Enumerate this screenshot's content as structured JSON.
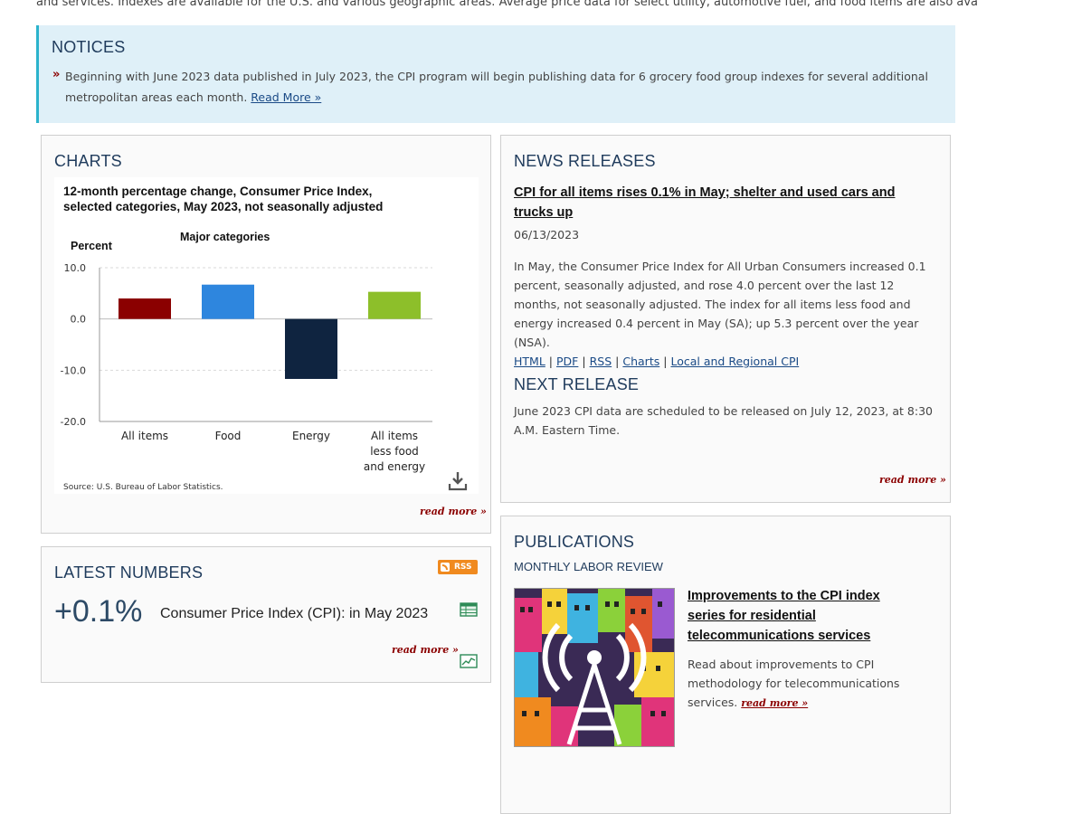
{
  "intro_text": "and services. Indexes are available for the U.S. and various geographic areas. Average price data for select utility, automotive fuel, and food items are also available.",
  "notices": {
    "heading": "NOTICES",
    "text": "Beginning with June 2023 data published in July 2023, the CPI program will begin publishing data for 6 grocery food group indexes for several additional metropolitan areas each month.",
    "read_more": "Read More »"
  },
  "charts": {
    "heading": "CHARTS",
    "read_more": "read more »"
  },
  "chart_data": {
    "type": "bar",
    "title": "12-month percentage change, Consumer Price Index, selected categories, May 2023, not seasonally adjusted",
    "subtitle": "Major categories",
    "ylabel": "Percent",
    "source": "Source: U.S. Bureau of Labor Statistics.",
    "ylim": [
      -20,
      10
    ],
    "yticks": [
      "10.0",
      "0.0",
      "-10.0",
      "-20.0"
    ],
    "grid": true,
    "categories": [
      "All items",
      "Food",
      "Energy",
      "All items less food and energy"
    ],
    "category_lines": [
      [
        "All items"
      ],
      [
        "Food"
      ],
      [
        "Energy"
      ],
      [
        "All items",
        "less food",
        "and energy"
      ]
    ],
    "values": [
      4.0,
      6.7,
      -11.7,
      5.3
    ],
    "colors": [
      "#8b0000",
      "#2e86de",
      "#0f2440",
      "#8dbf2a"
    ]
  },
  "latest": {
    "heading": "LATEST NUMBERS",
    "rss": "RSS",
    "value": "+0.1%",
    "label": "Consumer Price Index (CPI):",
    "period": "in May 2023",
    "read_more": "read more »"
  },
  "news": {
    "heading": "NEWS RELEASES",
    "headline": "CPI for all items rises 0.1% in May; shelter and used cars and trucks up",
    "date": "06/13/2023",
    "body": "In May, the Consumer Price Index for All Urban Consumers increased 0.1 percent, seasonally adjusted, and rose 4.0 percent over the last 12 months, not seasonally adjusted. The index for all items less food and energy increased 0.4 percent in May (SA); up 5.3 percent over the year (NSA).",
    "links": [
      "HTML",
      "PDF",
      "RSS",
      "Charts",
      "Local and Regional CPI"
    ],
    "next_heading": "NEXT RELEASE",
    "next_text": "June 2023 CPI data are scheduled to be released on July 12, 2023, at 8:30 A.M. Eastern Time.",
    "read_more": "read more »"
  },
  "publications": {
    "heading": "PUBLICATIONS",
    "subheading": "MONTHLY LABOR REVIEW",
    "title": "Improvements to the CPI index series for residential telecommunications services",
    "desc": "Read about improvements to CPI methodology for telecommunications services.",
    "read_more": "read more »"
  },
  "colors": {
    "heading": "#1f3b5c",
    "link": "#1a4a86",
    "readmore": "#8b0000",
    "notice_bg": "#dff0f8",
    "notice_border": "#2bb3cc",
    "value": "#2d4a66"
  }
}
